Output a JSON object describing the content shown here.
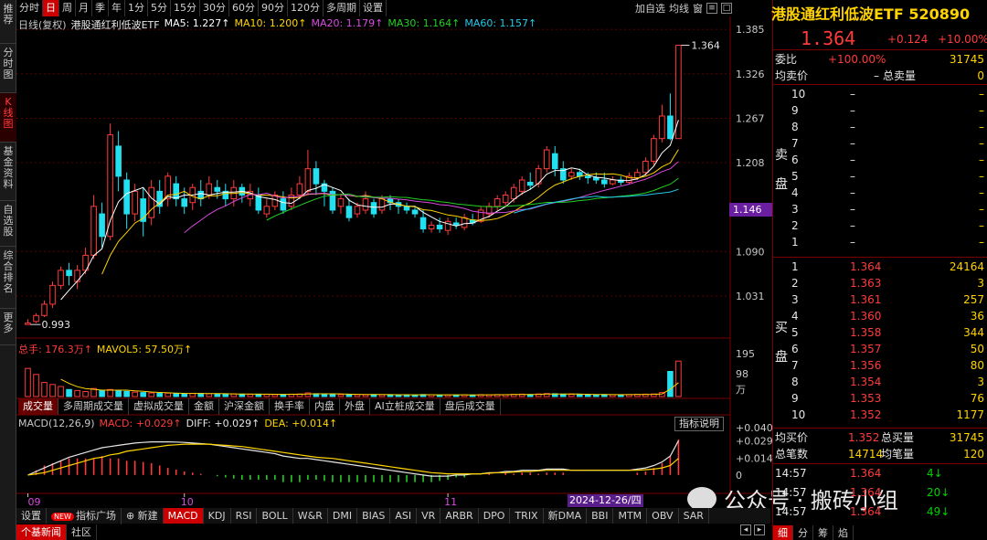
{
  "left_tabs": [
    {
      "label": "推荐"
    },
    {
      "label": "分时图"
    },
    {
      "label": "K线图"
    },
    {
      "label": "基金资料"
    },
    {
      "label": "自选股"
    },
    {
      "label": "综合排名"
    },
    {
      "label": "更多"
    }
  ],
  "periods": [
    "分时",
    "日",
    "周",
    "月",
    "季",
    "年",
    "1分",
    "5分",
    "15分",
    "30分",
    "60分",
    "90分",
    "120分",
    "多周期",
    "设置"
  ],
  "active_period": "日",
  "top_right": {
    "add_watch": "加自选",
    "equal": "均线",
    "icon1": "窗"
  },
  "legend_main": {
    "title": "日线(复权)",
    "name": "港股通红利低波ETF",
    "items": [
      {
        "text": "MA5: 1.227↑",
        "color": "#ffffff"
      },
      {
        "text": "MA10: 1.200↑",
        "color": "#ffd400"
      },
      {
        "text": "MA20: 1.179↑",
        "color": "#d94be0"
      },
      {
        "text": "MA30: 1.164↑",
        "color": "#22d022"
      },
      {
        "text": "MA60: 1.157↑",
        "color": "#24c8e8"
      }
    ]
  },
  "price_axis": [
    "1.385",
    "1.326",
    "1.267",
    "1.208",
    "1.090",
    "1.031"
  ],
  "current_price_box": "1.146",
  "annotations": {
    "high": "1.364",
    "low": "0.993"
  },
  "legend_vol": {
    "total": "总手: 176.3万↑",
    "mavol": "MAVOL5: 57.50万↑"
  },
  "vol_axis": [
    "195",
    "98",
    "万"
  ],
  "indicator_tabs": [
    "成交量",
    "多周期成交量",
    "虚拟成交量",
    "金额",
    "沪深金额",
    "换手率",
    "内盘",
    "外盘",
    "AI立桩成交量",
    "盘后成交量"
  ],
  "active_indicator": "成交量",
  "legend_macd": {
    "title": "MACD(12,26,9)",
    "macd": "MACD: +0.029↑",
    "diff": "DIFF: +0.029↑",
    "dea": "DEA: +0.014↑"
  },
  "macd_button": "指标说明",
  "macd_axis": [
    "+0.040",
    "+0.029",
    "+0.014",
    "0"
  ],
  "x_axis": [
    "09",
    "10",
    "11",
    "12"
  ],
  "date_box": "2024-12-26/四",
  "bottom_tabs": [
    "设置",
    "指标广场",
    "新建",
    "MACD",
    "KDJ",
    "RSI",
    "BOLL",
    "W&R",
    "DMI",
    "BIAS",
    "ASI",
    "VR",
    "ARBR",
    "DPO",
    "TRIX",
    "新DMA",
    "BBI",
    "MTM",
    "OBV",
    "SAR"
  ],
  "bottom_new_badge": "NEW",
  "active_bottom": "MACD",
  "bottom_tabs2": [
    "个基新闻",
    "社区"
  ],
  "watermark": "公众号 · 搬砖小组",
  "quote": {
    "title": "港股通红利低波ETF 520890",
    "price": "1.364",
    "change": "+0.124",
    "pct": "+10.00%",
    "weibi_label": "委比",
    "weibi": "+100.00%",
    "weicha": "31745",
    "jmj_label": "均卖价",
    "jmj": "–",
    "zmj_label": "总卖量",
    "zml": "0",
    "sell_label": [
      "卖",
      "盘"
    ],
    "sells": [
      {
        "lvl": "10",
        "p": "–",
        "v": "–"
      },
      {
        "lvl": "9",
        "p": "–",
        "v": "–"
      },
      {
        "lvl": "8",
        "p": "–",
        "v": "–"
      },
      {
        "lvl": "7",
        "p": "–",
        "v": "–"
      },
      {
        "lvl": "6",
        "p": "–",
        "v": "–"
      },
      {
        "lvl": "5",
        "p": "–",
        "v": "–"
      },
      {
        "lvl": "4",
        "p": "–",
        "v": "–"
      },
      {
        "lvl": "3",
        "p": "–",
        "v": "–"
      },
      {
        "lvl": "2",
        "p": "–",
        "v": "–"
      },
      {
        "lvl": "1",
        "p": "–",
        "v": "–"
      }
    ],
    "buy_label": [
      "买",
      "盘"
    ],
    "buys": [
      {
        "lvl": "1",
        "p": "1.364",
        "v": "24164"
      },
      {
        "lvl": "2",
        "p": "1.363",
        "v": "3"
      },
      {
        "lvl": "3",
        "p": "1.361",
        "v": "257"
      },
      {
        "lvl": "4",
        "p": "1.360",
        "v": "36"
      },
      {
        "lvl": "5",
        "p": "1.358",
        "v": "344"
      },
      {
        "lvl": "6",
        "p": "1.357",
        "v": "50"
      },
      {
        "lvl": "7",
        "p": "1.356",
        "v": "80"
      },
      {
        "lvl": "8",
        "p": "1.354",
        "v": "3"
      },
      {
        "lvl": "9",
        "p": "1.353",
        "v": "76"
      },
      {
        "lvl": "10",
        "p": "1.352",
        "v": "1177"
      }
    ],
    "jmr_label": "均买价",
    "jmr": "1.352",
    "zmr_label": "总买量",
    "zmr": "31745",
    "zbs_label": "总笔数",
    "zbs": "14714",
    "jbl_label": "均笔量",
    "jbl": "120",
    "ticks": [
      {
        "t": "14:57",
        "p": "1.364",
        "v": "4↓",
        "c": "green"
      },
      {
        "t": "14:57",
        "p": "1.364",
        "v": "20↓",
        "c": "green"
      },
      {
        "t": "14:57",
        "p": "1.364",
        "v": "49↓",
        "c": "green"
      }
    ],
    "bottom_tabs": [
      "细",
      "分",
      "筹",
      "焰"
    ]
  },
  "chart_data": {
    "type": "candlestick",
    "title": "港股通红利低波ETF",
    "x_labels": [
      "09",
      "10",
      "11",
      "12"
    ],
    "ylim": [
      0.975,
      1.395
    ],
    "candles": [
      [
        0.993,
        0.995,
        0.993,
        1.0
      ],
      [
        0.997,
        1.005,
        0.995,
        1.008
      ],
      [
        1.005,
        1.02,
        1.003,
        1.025
      ],
      [
        1.02,
        1.045,
        1.015,
        1.05
      ],
      [
        1.045,
        1.065,
        1.04,
        1.07
      ],
      [
        1.065,
        1.058,
        1.045,
        1.075
      ],
      [
        1.05,
        1.065,
        1.04,
        1.072
      ],
      [
        1.065,
        1.085,
        1.06,
        1.095
      ],
      [
        1.085,
        1.15,
        1.08,
        1.165
      ],
      [
        1.14,
        1.11,
        1.095,
        1.155
      ],
      [
        1.11,
        1.245,
        1.105,
        1.26
      ],
      [
        1.23,
        1.19,
        1.17,
        1.25
      ],
      [
        1.185,
        1.14,
        1.12,
        1.195
      ],
      [
        1.14,
        1.17,
        1.13,
        1.18
      ],
      [
        1.16,
        1.13,
        1.11,
        1.175
      ],
      [
        1.135,
        1.175,
        1.125,
        1.185
      ],
      [
        1.17,
        1.15,
        1.14,
        1.185
      ],
      [
        1.16,
        1.19,
        1.15,
        1.195
      ],
      [
        1.18,
        1.16,
        1.15,
        1.19
      ],
      [
        1.16,
        1.15,
        1.14,
        1.175
      ],
      [
        1.155,
        1.175,
        1.145,
        1.18
      ],
      [
        1.17,
        1.16,
        1.15,
        1.185
      ],
      [
        1.165,
        1.18,
        1.16,
        1.19
      ],
      [
        1.175,
        1.17,
        1.16,
        1.185
      ],
      [
        1.17,
        1.16,
        1.15,
        1.18
      ],
      [
        1.16,
        1.175,
        1.15,
        1.185
      ],
      [
        1.175,
        1.165,
        1.155,
        1.18
      ],
      [
        1.16,
        1.17,
        1.15,
        1.18
      ],
      [
        1.165,
        1.145,
        1.14,
        1.175
      ],
      [
        1.14,
        1.15,
        1.135,
        1.16
      ],
      [
        1.15,
        1.165,
        1.145,
        1.17
      ],
      [
        1.16,
        1.145,
        1.14,
        1.17
      ],
      [
        1.15,
        1.165,
        1.145,
        1.175
      ],
      [
        1.165,
        1.18,
        1.16,
        1.19
      ],
      [
        1.17,
        1.2,
        1.165,
        1.225
      ],
      [
        1.2,
        1.18,
        1.165,
        1.21
      ],
      [
        1.18,
        1.17,
        1.15,
        1.185
      ],
      [
        1.17,
        1.145,
        1.14,
        1.175
      ],
      [
        1.15,
        1.16,
        1.14,
        1.165
      ],
      [
        1.15,
        1.135,
        1.13,
        1.16
      ],
      [
        1.14,
        1.15,
        1.135,
        1.155
      ],
      [
        1.145,
        1.16,
        1.14,
        1.17
      ],
      [
        1.155,
        1.14,
        1.135,
        1.16
      ],
      [
        1.145,
        1.16,
        1.14,
        1.165
      ],
      [
        1.16,
        1.155,
        1.145,
        1.165
      ],
      [
        1.155,
        1.15,
        1.14,
        1.16
      ],
      [
        1.15,
        1.145,
        1.14,
        1.155
      ],
      [
        1.145,
        1.14,
        1.135,
        1.15
      ],
      [
        1.135,
        1.12,
        1.115,
        1.145
      ],
      [
        1.12,
        1.125,
        1.115,
        1.13
      ],
      [
        1.125,
        1.12,
        1.115,
        1.135
      ],
      [
        1.118,
        1.13,
        1.112,
        1.135
      ],
      [
        1.128,
        1.125,
        1.12,
        1.135
      ],
      [
        1.122,
        1.135,
        1.118,
        1.14
      ],
      [
        1.132,
        1.128,
        1.125,
        1.14
      ],
      [
        1.13,
        1.145,
        1.128,
        1.15
      ],
      [
        1.14,
        1.15,
        1.135,
        1.155
      ],
      [
        1.15,
        1.16,
        1.145,
        1.165
      ],
      [
        1.155,
        1.165,
        1.15,
        1.17
      ],
      [
        1.16,
        1.175,
        1.155,
        1.18
      ],
      [
        1.17,
        1.185,
        1.165,
        1.19
      ],
      [
        1.182,
        1.178,
        1.172,
        1.195
      ],
      [
        1.18,
        1.2,
        1.175,
        1.205
      ],
      [
        1.2,
        1.225,
        1.195,
        1.23
      ],
      [
        1.22,
        1.2,
        1.19,
        1.23
      ],
      [
        1.2,
        1.185,
        1.18,
        1.21
      ],
      [
        1.19,
        1.195,
        1.185,
        1.2
      ],
      [
        1.195,
        1.19,
        1.185,
        1.2
      ],
      [
        1.19,
        1.188,
        1.18,
        1.195
      ],
      [
        1.188,
        1.185,
        1.18,
        1.195
      ],
      [
        1.185,
        1.18,
        1.175,
        1.195
      ],
      [
        1.18,
        1.185,
        1.178,
        1.19
      ],
      [
        1.185,
        1.182,
        1.178,
        1.19
      ],
      [
        1.182,
        1.19,
        1.18,
        1.195
      ],
      [
        1.188,
        1.195,
        1.185,
        1.2
      ],
      [
        1.195,
        1.21,
        1.19,
        1.215
      ],
      [
        1.21,
        1.24,
        1.205,
        1.245
      ],
      [
        1.24,
        1.27,
        1.235,
        1.285
      ],
      [
        1.27,
        1.24,
        1.238,
        1.3
      ],
      [
        1.24,
        1.364,
        1.24,
        1.364
      ]
    ],
    "ma5": {
      "name": "MA5",
      "color": "#ffffff"
    },
    "ma10": {
      "name": "MA10",
      "color": "#ffd400"
    },
    "ma20": {
      "name": "MA20",
      "color": "#d94be0"
    },
    "ma30": {
      "name": "MA30",
      "color": "#22d022"
    },
    "ma60": {
      "name": "MA60",
      "color": "#24c8e8"
    },
    "volume_ylim": [
      0,
      2000000
    ],
    "volume": [
      1400000,
      1100000,
      700000,
      600000,
      500000,
      350000,
      300000,
      250000,
      400000,
      300000,
      350000,
      280000,
      260000,
      220000,
      200000,
      180000,
      160000,
      170000,
      150000,
      140000,
      160000,
      150000,
      140000,
      130000,
      120000,
      130000,
      120000,
      110000,
      120000,
      110000,
      100000,
      110000,
      120000,
      130000,
      180000,
      140000,
      120000,
      110000,
      100000,
      110000,
      100000,
      90000,
      100000,
      90000,
      95000,
      85000,
      90000,
      80000,
      100000,
      90000,
      80000,
      85000,
      80000,
      90000,
      80000,
      95000,
      90000,
      100000,
      95000,
      110000,
      120000,
      100000,
      130000,
      150000,
      140000,
      120000,
      110000,
      100000,
      95000,
      90000,
      100000,
      95000,
      90000,
      100000,
      110000,
      120000,
      130000,
      200000,
      1250000,
      1763000
    ],
    "macd_ylim": [
      -0.014,
      0.04
    ],
    "diff": [
      0.0,
      0.003,
      0.006,
      0.009,
      0.012,
      0.015,
      0.017,
      0.019,
      0.021,
      0.023,
      0.024,
      0.025,
      0.026,
      0.027,
      0.0275,
      0.028,
      0.028,
      0.028,
      0.0278,
      0.0275,
      0.027,
      0.0265,
      0.026,
      0.025,
      0.024,
      0.023,
      0.022,
      0.021,
      0.02,
      0.019,
      0.018,
      0.016,
      0.015,
      0.014,
      0.014,
      0.013,
      0.012,
      0.011,
      0.01,
      0.009,
      0.008,
      0.007,
      0.006,
      0.005,
      0.004,
      0.003,
      0.002,
      0.001,
      0.0,
      -0.001,
      -0.001,
      -0.001,
      0.0,
      0.0,
      0.001,
      0.001,
      0.002,
      0.002,
      0.003,
      0.003,
      0.004,
      0.004,
      0.004,
      0.005,
      0.005,
      0.005,
      0.004,
      0.004,
      0.004,
      0.004,
      0.004,
      0.004,
      0.004,
      0.004,
      0.005,
      0.006,
      0.008,
      0.011,
      0.016,
      0.029
    ],
    "dea": [
      0.0,
      0.001,
      0.002,
      0.004,
      0.006,
      0.008,
      0.01,
      0.012,
      0.014,
      0.015,
      0.017,
      0.018,
      0.02,
      0.021,
      0.022,
      0.023,
      0.024,
      0.025,
      0.0255,
      0.026,
      0.026,
      0.026,
      0.026,
      0.0255,
      0.025,
      0.0245,
      0.024,
      0.023,
      0.022,
      0.021,
      0.02,
      0.019,
      0.018,
      0.017,
      0.016,
      0.015,
      0.0145,
      0.014,
      0.013,
      0.012,
      0.011,
      0.01,
      0.009,
      0.008,
      0.007,
      0.006,
      0.005,
      0.004,
      0.003,
      0.002,
      0.0015,
      0.001,
      0.001,
      0.001,
      0.001,
      0.001,
      0.0015,
      0.002,
      0.002,
      0.0025,
      0.003,
      0.003,
      0.0035,
      0.004,
      0.004,
      0.004,
      0.004,
      0.004,
      0.004,
      0.004,
      0.004,
      0.004,
      0.004,
      0.004,
      0.004,
      0.0045,
      0.005,
      0.006,
      0.008,
      0.014
    ],
    "colors": {
      "up": "#ff3b3b",
      "down": "#22e0f0",
      "grid": "#5a0000"
    }
  }
}
